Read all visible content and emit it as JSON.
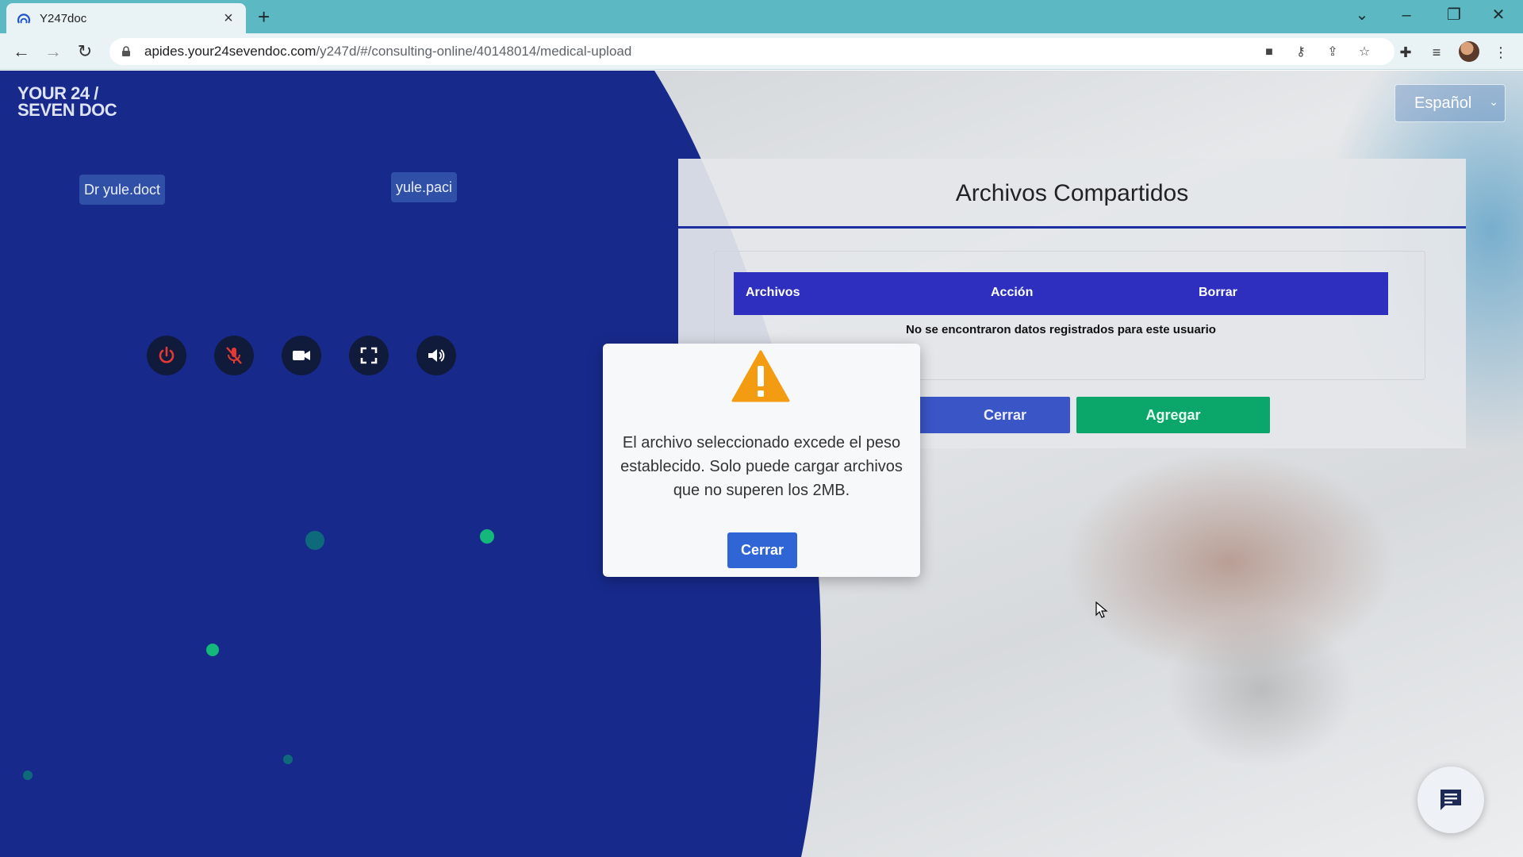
{
  "browser": {
    "tab_title": "Y247doc",
    "url_host": "apides.your24sevendoc.com",
    "url_path": "/y247d/#/consulting-online/40148014/medical-upload",
    "icons": [
      "back-icon",
      "forward-icon",
      "reload-icon",
      "lock-icon",
      "camera-icon",
      "key-icon",
      "share-icon",
      "star-icon",
      "extensions-icon",
      "media-icon",
      "menu-icon"
    ]
  },
  "header": {
    "logo_line1": "YOUR 24 /",
    "logo_line2": "SEVEN DOC",
    "language": "Español"
  },
  "call": {
    "doctor_name": "Dr yule.doct",
    "patient_name": "yule.paci",
    "controls": [
      "power-icon",
      "mic-off-icon",
      "video-camera-icon",
      "fullscreen-icon",
      "volume-icon"
    ]
  },
  "files": {
    "title": "Archivos Compartidos",
    "col_files": "Archivos",
    "col_action": "Acción",
    "col_delete": "Borrar",
    "empty_message": "No se encontraron datos registrados para este usuario",
    "close_label": "Cerrar",
    "add_label": "Agregar"
  },
  "modal": {
    "message": "El archivo seleccionado excede el peso establecido. Solo puede cargar archivos que no superen los 2MB.",
    "close_label": "Cerrar"
  },
  "colors": {
    "page_blue": "#172a8c",
    "table_header": "#2f2fbf",
    "add_button": "#0aa66a",
    "modal_button": "#3065d6",
    "warning": "#f39c12"
  }
}
